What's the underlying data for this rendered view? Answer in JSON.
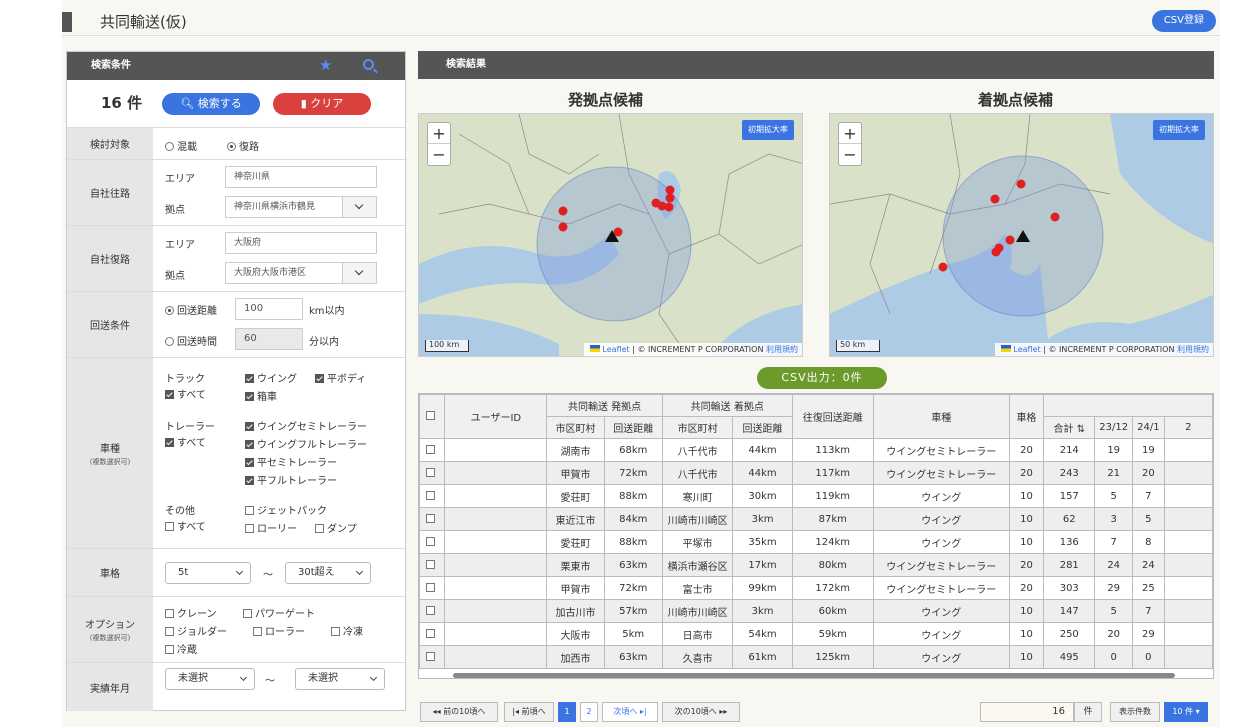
{
  "header": {
    "title": "共同輸送(仮)",
    "csv_register": "CSV登録"
  },
  "search": {
    "panel_title": "検索条件",
    "count": "16 件",
    "search_button": "検索する",
    "clear_button": "クリア",
    "target": {
      "label": "検討対象",
      "options": [
        "混載",
        "復路"
      ],
      "selected": "復路"
    },
    "own_outbound": {
      "label": "自社往路",
      "area_label": "エリア",
      "area": "神奈川県",
      "base_label": "拠点",
      "base": "神奈川県横浜市鶴見"
    },
    "own_return": {
      "label": "自社復路",
      "area_label": "エリア",
      "area": "大阪府",
      "base_label": "拠点",
      "base": "大阪府大阪市港区"
    },
    "return_cond": {
      "label": "回送条件",
      "distance_label": "回送距離",
      "distance": "100",
      "distance_unit": "km以内",
      "time_label": "回送時間",
      "time": "60",
      "time_unit": "分以内",
      "selected": "回送距離"
    },
    "vehicle": {
      "label": "車種",
      "note": "(複数選択可)",
      "truck_label": "トラック",
      "truck_all": "すべて",
      "truck_items": [
        "ウイング",
        "平ボディ",
        "箱車"
      ],
      "trailer_label": "トレーラー",
      "trailer_all": "すべて",
      "trailer_items": [
        "ウイングセミトレーラー",
        "ウイングフルトレーラー",
        "平セミトレーラー",
        "平フルトレーラー"
      ],
      "other_label": "その他",
      "other_all": "すべて",
      "other_items": [
        "ジェットパック",
        "ローリー",
        "ダンプ"
      ]
    },
    "size": {
      "label": "車格",
      "from": "5t",
      "tilde": "～",
      "to": "30t超え"
    },
    "option": {
      "label": "オプション",
      "note": "(複数選択可)",
      "items": [
        "クレーン",
        "パワーゲート",
        "ジョルダー",
        "ローラー",
        "冷凍",
        "冷蔵"
      ]
    },
    "period": {
      "label": "実績年月",
      "from": "未選択",
      "tilde": "～",
      "to": "未選択"
    }
  },
  "results": {
    "panel_title": "検索結果",
    "map_origin": {
      "title": "発拠点候補",
      "init_zoom": "初期拡大率",
      "scale": "100 km",
      "attrib_leaflet": "Leaflet",
      "attrib_text": "| © INCREMENT P CORPORATION",
      "attrib_terms": "利用規約",
      "zoom_in": "+",
      "zoom_out": "−"
    },
    "map_dest": {
      "title": "着拠点候補",
      "init_zoom": "初期拡大率",
      "scale": "50 km",
      "attrib_leaflet": "Leaflet",
      "attrib_text": "| © INCREMENT P CORPORATION",
      "attrib_terms": "利用規約",
      "zoom_in": "+",
      "zoom_out": "−"
    },
    "csv_output": "CSV出力：0件",
    "table": {
      "h_user": "ユーザーID",
      "h_origin": "共同輸送 発拠点",
      "h_dest": "共同輸送 着拠点",
      "h_city": "市区町村",
      "h_dist": "回送距離",
      "h_round": "往復回送距離",
      "h_type": "車種",
      "h_size": "車格",
      "h_total": "合計 ⇅",
      "h_m1": "23/12",
      "h_m2": "24/1",
      "h_m3": "2",
      "rows": [
        {
          "o_city": "湖南市",
          "o_dist": "68km",
          "d_city": "八千代市",
          "d_dist": "44km",
          "round": "113km",
          "type": "ウイングセミトレーラー",
          "size": "20",
          "total": "214",
          "m1": "19",
          "m2": "19"
        },
        {
          "o_city": "甲賀市",
          "o_dist": "72km",
          "d_city": "八千代市",
          "d_dist": "44km",
          "round": "117km",
          "type": "ウイングセミトレーラー",
          "size": "20",
          "total": "243",
          "m1": "21",
          "m2": "20"
        },
        {
          "o_city": "愛荘町",
          "o_dist": "88km",
          "d_city": "寒川町",
          "d_dist": "30km",
          "round": "119km",
          "type": "ウイング",
          "size": "10",
          "total": "157",
          "m1": "5",
          "m2": "7"
        },
        {
          "o_city": "東近江市",
          "o_dist": "84km",
          "d_city": "川崎市川崎区",
          "d_dist": "3km",
          "round": "87km",
          "type": "ウイング",
          "size": "10",
          "total": "62",
          "m1": "3",
          "m2": "5"
        },
        {
          "o_city": "愛荘町",
          "o_dist": "88km",
          "d_city": "平塚市",
          "d_dist": "35km",
          "round": "124km",
          "type": "ウイング",
          "size": "10",
          "total": "136",
          "m1": "7",
          "m2": "8"
        },
        {
          "o_city": "栗東市",
          "o_dist": "63km",
          "d_city": "横浜市瀬谷区",
          "d_dist": "17km",
          "round": "80km",
          "type": "ウイングセミトレーラー",
          "size": "20",
          "total": "281",
          "m1": "24",
          "m2": "24"
        },
        {
          "o_city": "甲賀市",
          "o_dist": "72km",
          "d_city": "富士市",
          "d_dist": "99km",
          "round": "172km",
          "type": "ウイングセミトレーラー",
          "size": "20",
          "total": "303",
          "m1": "29",
          "m2": "25"
        },
        {
          "o_city": "加古川市",
          "o_dist": "57km",
          "d_city": "川崎市川崎区",
          "d_dist": "3km",
          "round": "60km",
          "type": "ウイング",
          "size": "10",
          "total": "147",
          "m1": "5",
          "m2": "7"
        },
        {
          "o_city": "大阪市",
          "o_dist": "5km",
          "d_city": "日高市",
          "d_dist": "54km",
          "round": "59km",
          "type": "ウイング",
          "size": "10",
          "total": "250",
          "m1": "20",
          "m2": "29"
        },
        {
          "o_city": "加西市",
          "o_dist": "63km",
          "d_city": "久喜市",
          "d_dist": "61km",
          "round": "125km",
          "type": "ウイング",
          "size": "10",
          "total": "495",
          "m1": "0",
          "m2": "0"
        }
      ]
    },
    "pager": {
      "prev10": "前の10頃へ",
      "prev": "前頃へ",
      "pages": [
        "1",
        "2"
      ],
      "next": "次頃へ",
      "next10": "次の10頃へ",
      "total": "16",
      "total_unit": "件",
      "per_page_label": "表示件数",
      "per_page": "10 件"
    }
  },
  "colors": {
    "accent": "#3a74e0",
    "danger": "#d9403e",
    "csv_green": "#6c9a2b",
    "header_gray": "#555555",
    "marker": "#e02020"
  }
}
